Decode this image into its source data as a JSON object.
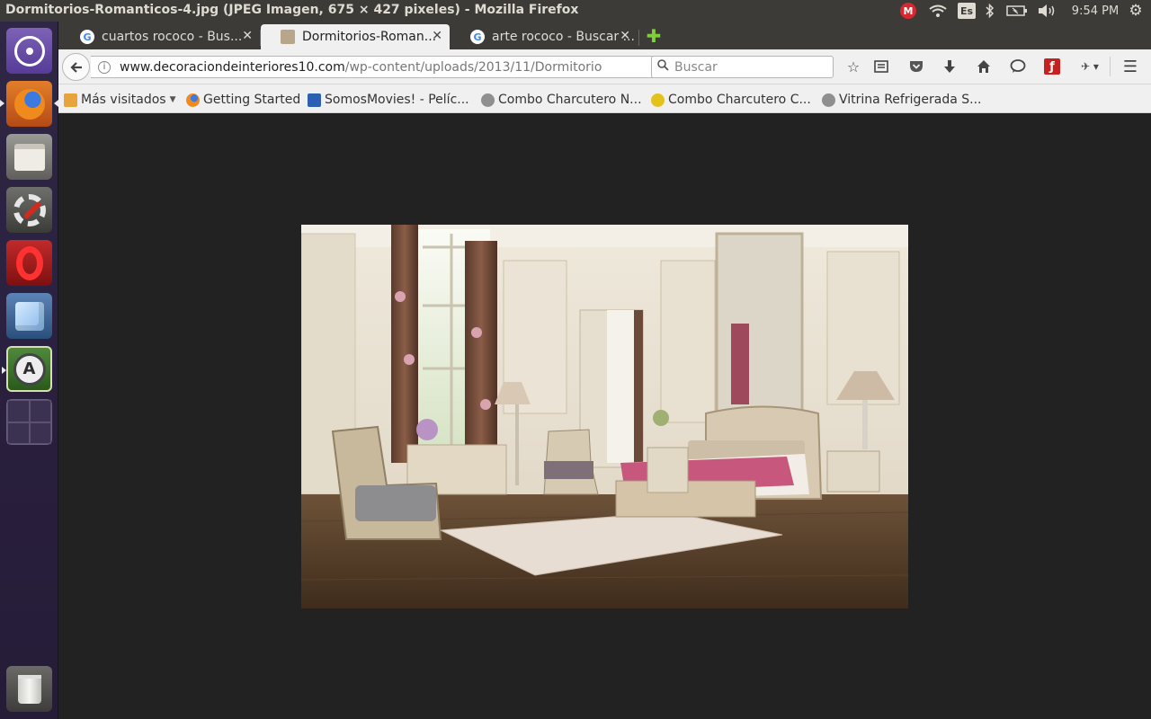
{
  "window_title": "Dormitorios-Romanticos-4.jpg (JPEG Imagen, 675 × 427 pixeles) - Mozilla Firefox",
  "tray": {
    "mega": "M",
    "keyboard": "Es",
    "clock": "9:54 PM"
  },
  "tabs": [
    {
      "label": "cuartos rococo - Bus...",
      "favicon": "G"
    },
    {
      "label": "Dormitorios-Roman...",
      "favicon": ""
    },
    {
      "label": "arte rococo - Buscar ...",
      "favicon": "G"
    }
  ],
  "url": {
    "domain": "www.decoraciondeinteriores10.com",
    "path": "/wp-content/uploads/2013/11/Dormitorio"
  },
  "search": {
    "placeholder": "Buscar"
  },
  "bookmarks": [
    {
      "label": "Más visitados"
    },
    {
      "label": "Getting Started"
    },
    {
      "label": "SomosMovies! - Pelíc..."
    },
    {
      "label": "Combo Charcutero N..."
    },
    {
      "label": "Combo Charcutero C..."
    },
    {
      "label": "Vitrina Refrigerada S..."
    }
  ],
  "launcher": [
    {
      "name": "Dash"
    },
    {
      "name": "Firefox"
    },
    {
      "name": "Files"
    },
    {
      "name": "System Settings"
    },
    {
      "name": "Opera"
    },
    {
      "name": "Cube"
    },
    {
      "name": "Software Updater"
    },
    {
      "name": "Workspaces"
    },
    {
      "name": "Trash"
    }
  ],
  "colors": {
    "panel": "#3c3b37",
    "launcher": "#2b2140",
    "viewer_bg": "#222222",
    "accent_add": "#7fcf3a"
  }
}
